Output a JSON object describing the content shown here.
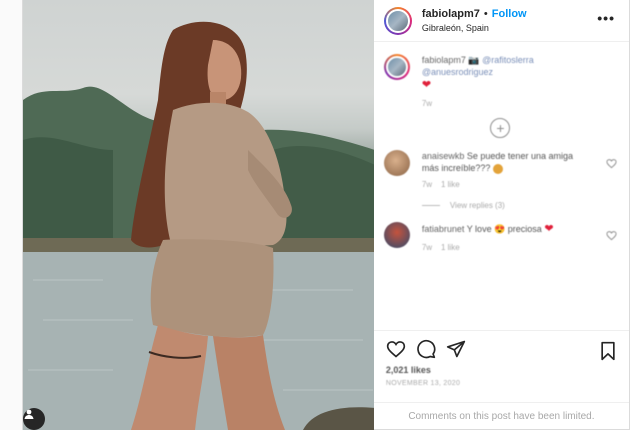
{
  "header": {
    "username": "fabiolapm7",
    "separator": "•",
    "follow_label": "Follow",
    "location": "Gibraleón, Spain",
    "more_icon": "more-horizontal-icon"
  },
  "caption": {
    "username": "fabiolapm7",
    "text": "📷 @rafitoslerra @anuesrodriguez",
    "time": "7w"
  },
  "comments": [
    {
      "username": "anaisewkb",
      "text": "Se puede tener una amiga más increíble???",
      "time": "7w",
      "likes": "1 like",
      "view_replies": "View replies (3)"
    },
    {
      "username": "fatiabrunet",
      "text": "Y love 😍 preciosa",
      "time": "7w",
      "likes": "1 like"
    }
  ],
  "actions": {
    "likes": "2,021 likes",
    "date": "NOVEMBER 13, 2020"
  },
  "footer": {
    "comments_limited": "Comments on this post have been limited."
  },
  "colors": {
    "link_blue": "#0095f6",
    "heart_red": "#e0203a",
    "border": "#dbdbdb"
  }
}
